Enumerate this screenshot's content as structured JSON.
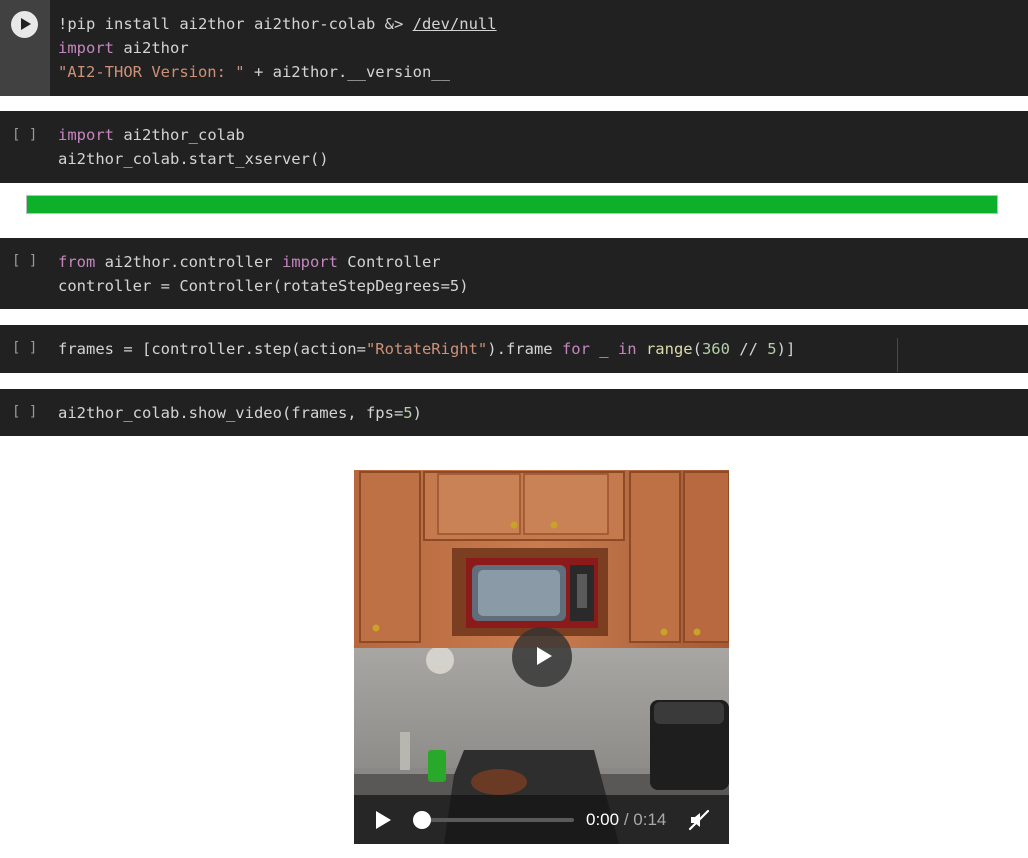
{
  "cells": [
    {
      "id": "pip-install",
      "state": "running",
      "lines": [
        [
          {
            "t": "!pip install ai2thor ai2thor-colab &> ",
            "c": "plain"
          },
          {
            "t": "/dev/null",
            "c": "link"
          }
        ],
        [
          {
            "t": "import",
            "c": "kw"
          },
          {
            "t": " ai2thor",
            "c": "plain"
          }
        ],
        [
          {
            "t": "\"AI2-THOR Version: \"",
            "c": "str"
          },
          {
            "t": " + ai2thor.__version__",
            "c": "plain"
          }
        ]
      ]
    },
    {
      "id": "start-xserver",
      "prompt": "[ ]",
      "lines": [
        [
          {
            "t": "import",
            "c": "kw"
          },
          {
            "t": " ai2thor_colab",
            "c": "plain"
          }
        ],
        [
          {
            "t": "ai2thor_colab.start_xserver()",
            "c": "plain"
          }
        ]
      ]
    },
    {
      "id": "controller",
      "prompt": "[ ]",
      "lines": [
        [
          {
            "t": "from",
            "c": "kw"
          },
          {
            "t": " ai2thor.controller ",
            "c": "plain"
          },
          {
            "t": "import",
            "c": "kw"
          },
          {
            "t": " Controller",
            "c": "plain"
          }
        ],
        [
          {
            "t": "controller = Controller(rotateStepDegrees=5)",
            "c": "plain"
          }
        ]
      ]
    },
    {
      "id": "frames",
      "prompt": "[ ]",
      "lines": [
        [
          {
            "t": "frames = [controller.step(action=",
            "c": "plain"
          },
          {
            "t": "\"RotateRight\"",
            "c": "str"
          },
          {
            "t": ").frame ",
            "c": "plain"
          },
          {
            "t": "for",
            "c": "kw"
          },
          {
            "t": " _ ",
            "c": "plain"
          },
          {
            "t": "in",
            "c": "kw"
          },
          {
            "t": " ",
            "c": "plain"
          },
          {
            "t": "range",
            "c": "bi"
          },
          {
            "t": "(",
            "c": "plain"
          },
          {
            "t": "360",
            "c": "num"
          },
          {
            "t": " // ",
            "c": "plain"
          },
          {
            "t": "5",
            "c": "num"
          },
          {
            "t": ")]",
            "c": "plain"
          }
        ]
      ]
    },
    {
      "id": "show-video",
      "prompt": "[ ]",
      "lines": [
        [
          {
            "t": "ai2thor_colab.show_video(frames, fps=",
            "c": "plain"
          },
          {
            "t": "5",
            "c": "num"
          },
          {
            "t": ")",
            "c": "plain"
          }
        ]
      ]
    }
  ],
  "progress": {
    "value": 1.0,
    "color": "#0db02b"
  },
  "video": {
    "current_time": "0:00",
    "separator": "/",
    "duration": "0:14",
    "position": 0.0,
    "muted": true,
    "icons": [
      "big-play-icon",
      "play-icon",
      "mute-icon"
    ]
  },
  "colors": {
    "cell_bg": "#212121",
    "keyword": "#c586c0",
    "string": "#ce9178",
    "number": "#b5cea8",
    "builtin": "#dcdcaa"
  }
}
